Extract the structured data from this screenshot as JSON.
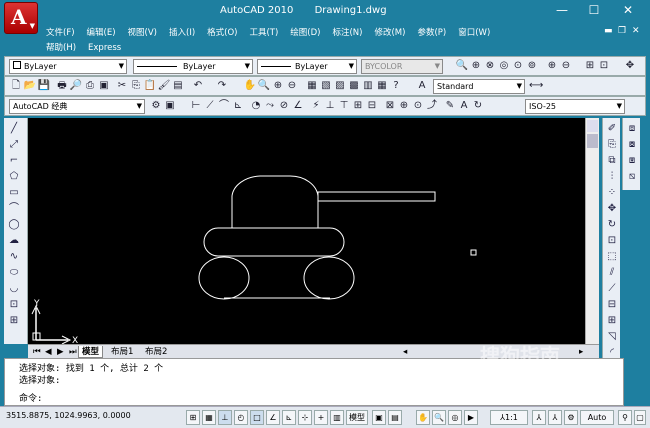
{
  "title": {
    "app": "AutoCAD 2010",
    "doc": "Drawing1.dwg"
  },
  "menu": {
    "row1": [
      "文件(F)",
      "编辑(E)",
      "视图(V)",
      "插入(I)",
      "格式(O)",
      "工具(T)",
      "绘图(D)",
      "标注(N)",
      "修改(M)",
      "参数(P)",
      "窗口(W)"
    ],
    "row2": [
      "帮助(H)",
      "Express"
    ]
  },
  "properties": {
    "layer": "ByLayer",
    "linetype": "ByLayer",
    "lineweight": "ByLayer",
    "color": "BYCOLOR"
  },
  "styles": {
    "text_style": "Standard",
    "dim_style": "ISO-25"
  },
  "workspace": "AutoCAD 经典",
  "layout_tabs": [
    "模型",
    "布局1",
    "布局2"
  ],
  "command": {
    "history": [
      "选择对象: 找到 1 个, 总计 2 个",
      "选择对象:"
    ],
    "prompt": "命令:"
  },
  "status": {
    "coords": "3515.8875, 1024.9963, 0.0000",
    "model_label": "模型",
    "scale": "1:1",
    "auto": "Auto"
  },
  "watermark": "搜狗指南",
  "axis": {
    "y": "Y",
    "x": "X"
  },
  "colors": {
    "title_bg": "#1e7fa0",
    "canvas_bg": "#000000",
    "drawing": "#ffffff",
    "app_button": "#c62828"
  },
  "icons": {
    "app": "A",
    "minimize": "—",
    "maximize": "☐",
    "close": "✕"
  }
}
